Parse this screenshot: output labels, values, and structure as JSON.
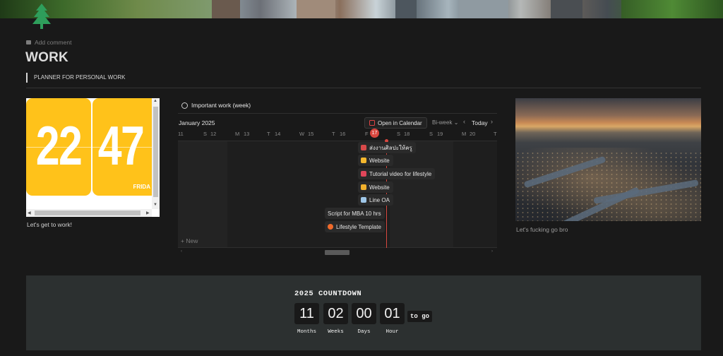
{
  "page": {
    "add_comment": "Add comment",
    "title": "WORK",
    "quote": "PLANNER FOR PERSONAL WORK"
  },
  "clock": {
    "hours": "22",
    "minutes": "47",
    "day": "FRIDA",
    "caption": "Let's get to work!"
  },
  "timeline": {
    "title": "Important work (week)",
    "month": "January 2025",
    "open_calendar": "Open in Calendar",
    "view": "Bi-week",
    "today": "Today",
    "days": [
      "11",
      "S",
      "12",
      "M",
      "13",
      "T",
      "14",
      "W",
      "15",
      "T",
      "16",
      "F",
      "17",
      "S",
      "18",
      "S",
      "19",
      "M",
      "20",
      "T"
    ],
    "items": [
      {
        "label": "ส่งงานศิลปะให้ครู",
        "icon": "pencil-icon",
        "color": "#d94a4a"
      },
      {
        "label": "Website",
        "icon": "rainbow-icon",
        "color": "#f5b82e"
      },
      {
        "label": "Tutorial video for lifestyle",
        "icon": "bow-icon",
        "color": "#e0465a"
      },
      {
        "label": "Website",
        "icon": "face-icon",
        "color": "#f0b02c"
      },
      {
        "label": "Line OA",
        "icon": "cloud-icon",
        "color": "#9fc7e8"
      },
      {
        "label": "Script for MBA 10 hrs",
        "icon": "",
        "color": ""
      },
      {
        "label": "Lifestyle Template",
        "icon": "fire-icon",
        "color": "#f06a2a"
      }
    ],
    "new": "New"
  },
  "photo": {
    "caption": "Let's fucking go bro"
  },
  "countdown": {
    "title": "2025 COUNTDOWN",
    "months": "11",
    "weeks": "02",
    "days": "00",
    "hours": "01",
    "to_go": "to go",
    "label_months": "Months",
    "label_weeks": "Weeks",
    "label_days": "Days",
    "label_hours": "Hour"
  }
}
